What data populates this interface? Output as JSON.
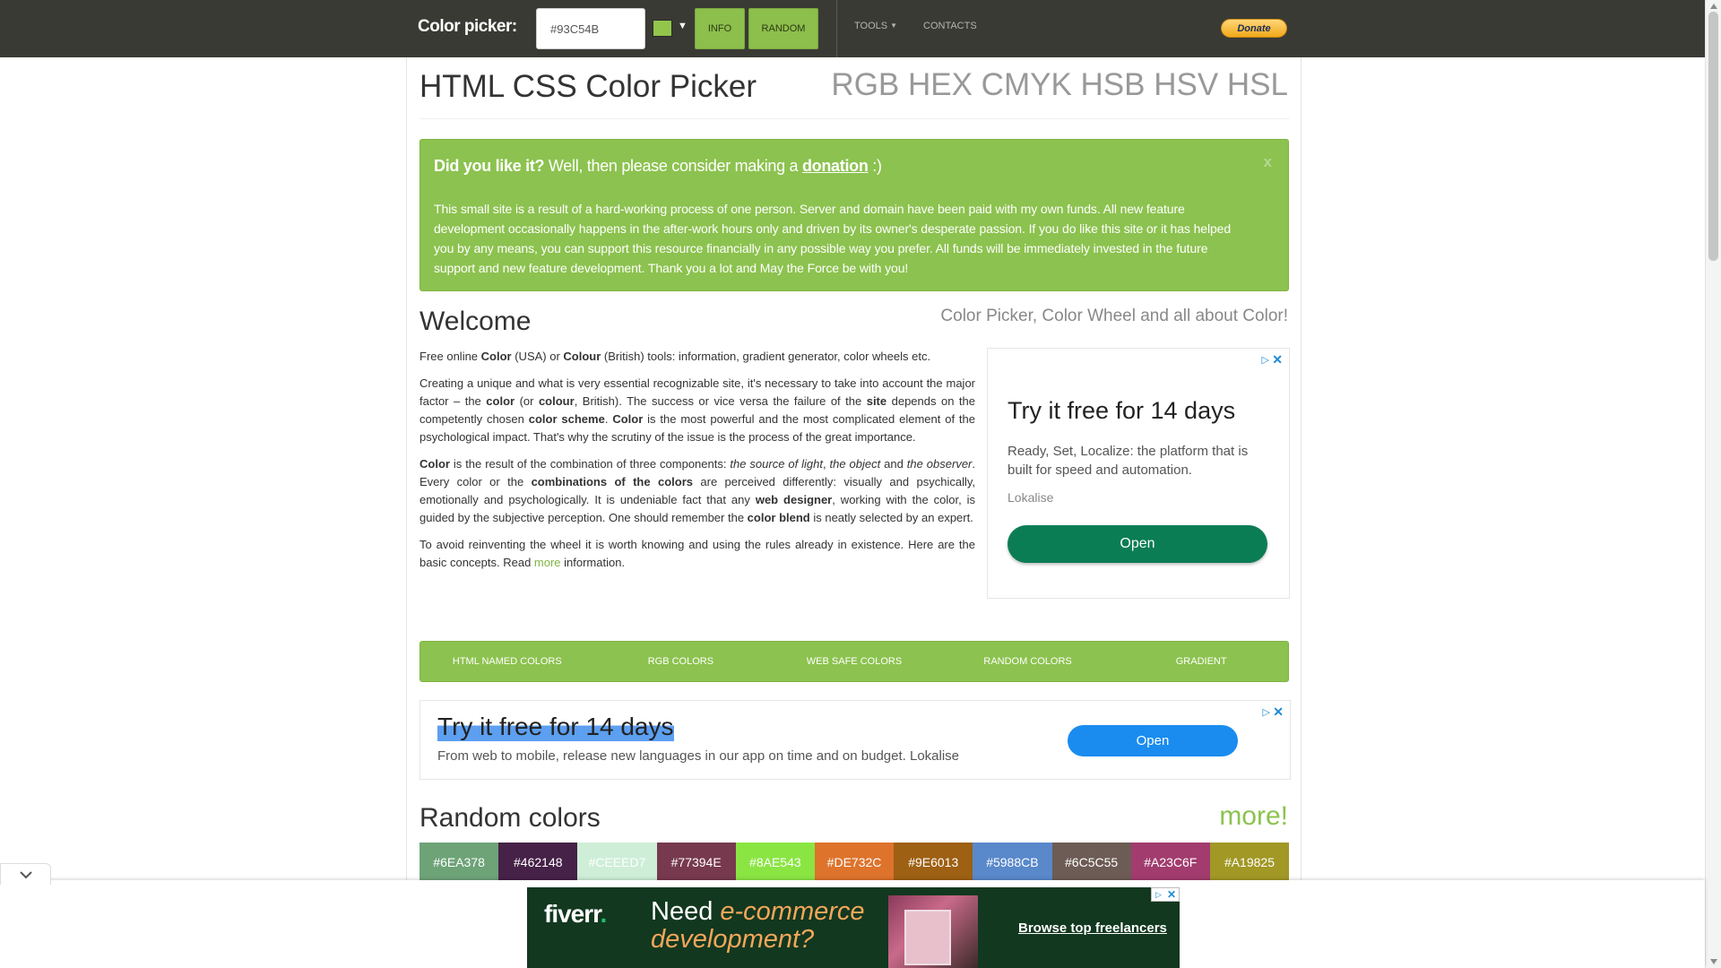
{
  "navbar": {
    "brand": "Color picker:",
    "color_value": "#93C54B",
    "swatch_color": "#93C54B",
    "info_label": "INFO",
    "random_label": "RANDOM",
    "tools_label": "TOOLS",
    "contacts_label": "CONTACTS",
    "donate_label": "Donate"
  },
  "page": {
    "title": "HTML CSS Color Picker",
    "formats": "RGB HEX CMYK HSB HSV HSL"
  },
  "alert": {
    "lead_bold": "Did you like it?",
    "lead_text": " Well, then please consider making a ",
    "donation_link": "donation",
    "lead_end": " :)",
    "close": "x",
    "body": "This small site is a result of a hard-working process of one person. Server and domain have been paid with my own funds. All new feature development occasionally happens in the after-work hours only and driven by its owner's desperate passion. If you do like this site or it has helped you by any means, you can support this resource financially in any possible way you prefer. All funds will be immediately invested in the future support and new feature development. Thank you a lot and May the Force be with you!"
  },
  "welcome": {
    "heading": "Welcome",
    "subheading": "Color Picker, Color Wheel and all about Color!",
    "p1": {
      "t1": "Free online ",
      "b1": "Color",
      "t2": " (USA) or ",
      "b2": "Colour",
      "t3": " (British) tools: information, gradient generator, color wheels etc."
    },
    "p2": {
      "t1": "Creating a unique and what is very essential recognizable site, it's necessary to take into account the major factor – the ",
      "b1": "color",
      "t2": " (or ",
      "b2": "colour",
      "t3": ", British). The success or vice versa the failure of the ",
      "b3": "site",
      "t4": " depends on the competently chosen ",
      "b4": "color scheme",
      "t5": ". ",
      "b5": "Color",
      "t6": " is the most powerful and the most complicated element of the psychological impact. That's why the scrutiny of the issue is the process of the great importance."
    },
    "p3": {
      "b1": "Color",
      "t1": " is the result of the combination of three components: ",
      "i1": "the source of light",
      "t2": ", ",
      "i2": "the object",
      "t3": " and ",
      "i3": "the observer",
      "t4": ". Every color or the ",
      "b2": "combinations of the colors",
      "t5": " are perceived differently: visually and psychically, emotionally and psychologically. It is undeniable fact that any ",
      "b3": "web designer",
      "t6": ", working with the color, is guided by the subjective perception. One should remember the ",
      "b4": "color blend",
      "t7": " is neatly selected by an expert."
    },
    "p4": {
      "t1": "To avoid reinventing the wheel it is worth knowing and using the rules already in existence. Here are the basic concepts. Read ",
      "link": "more",
      "t2": " information."
    }
  },
  "ad_side": {
    "title": "Try it free for 14 days",
    "desc": "Ready, Set, Localize: the platform that is built for speed and automation.",
    "brand": "Lokalise",
    "button": "Open"
  },
  "categories": [
    "HTML NAMED COLORS",
    "RGB COLORS",
    "WEB SAFE COLORS",
    "RANDOM COLORS",
    "GRADIENT"
  ],
  "ad_banner": {
    "title": "Try it free for 14 days",
    "desc": "From web to mobile, release new languages in our app on time and on budget. Lokalise",
    "button": "Open"
  },
  "random_colors": {
    "heading": "Random colors",
    "more": "more!",
    "swatches": [
      "#6EA378",
      "#462148",
      "#CEEED7",
      "#77394E",
      "#8AE543",
      "#DE732C",
      "#9E6013",
      "#5988CB",
      "#6C5C55",
      "#A23C6F",
      "#A19825"
    ]
  },
  "bottom_ad": {
    "logo": "fiverr",
    "logo_dot": ".",
    "line1": "Need ",
    "line1_em": "e-commerce",
    "line2_em": "development?",
    "link": "Browse top freelancers"
  },
  "colors": {
    "accent": "#8CC24F",
    "navbar": "#3A3A35"
  }
}
